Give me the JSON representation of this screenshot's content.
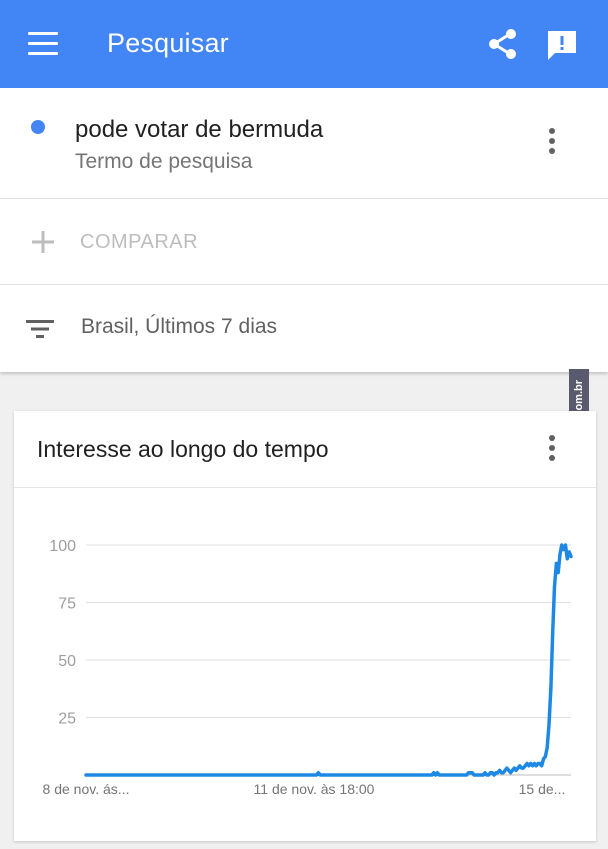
{
  "app_bar": {
    "title": "Pesquisar",
    "color": "#4285f4",
    "icons": [
      "menu-icon",
      "share-icon",
      "feedback-icon"
    ]
  },
  "search_term": {
    "name": "pode votar de bermuda",
    "type": "Termo de pesquisa",
    "color": "#4285f4"
  },
  "compare": {
    "label": "COMPARAR"
  },
  "filter": {
    "label": "Brasil, Últimos 7 dias"
  },
  "watermark": {
    "text": "AhNegao.com.br"
  },
  "chart_card": {
    "title": "Interesse ao longo do tempo"
  },
  "chart_data": {
    "type": "line",
    "title": "Interesse ao longo do tempo",
    "xlabel": "",
    "ylabel": "",
    "x_tick_labels": [
      "8 de nov. ás...",
      "11 de nov. às 18:00",
      "15 de..."
    ],
    "y_ticks": [
      25,
      50,
      75,
      100
    ],
    "ylim": [
      0,
      100
    ],
    "grid": true,
    "series": [
      {
        "color": "#1e88e5",
        "values": [
          0,
          0,
          0,
          0,
          0,
          0,
          0,
          0,
          0,
          0,
          0,
          0,
          0,
          0,
          0,
          0,
          0,
          0,
          0,
          0,
          0,
          0,
          0,
          0,
          0,
          0,
          0,
          0,
          0,
          0,
          0,
          0,
          0,
          0,
          0,
          0,
          0,
          0,
          0,
          0,
          0,
          0,
          0,
          0,
          0,
          0,
          0,
          0,
          0,
          0,
          0,
          0,
          0,
          0,
          0,
          0,
          0,
          0,
          0,
          0,
          0,
          0,
          0,
          0,
          0,
          0,
          0,
          0,
          0,
          0,
          0,
          0,
          0,
          0,
          0,
          0,
          0,
          0,
          0,
          0,
          0,
          0,
          0,
          0,
          0,
          0,
          0,
          0,
          0,
          0,
          0,
          0,
          0,
          0,
          0,
          0,
          0,
          0,
          0,
          0,
          0,
          0,
          0,
          0,
          0,
          0,
          0,
          0,
          0,
          0,
          0,
          0,
          0,
          0,
          0,
          0,
          0,
          0,
          0,
          0,
          0,
          0,
          0,
          0,
          0,
          0,
          0,
          1,
          0,
          0,
          0,
          0,
          0,
          0,
          0,
          0,
          0,
          0,
          0,
          0,
          0,
          0,
          0,
          0,
          0,
          0,
          0,
          0,
          0,
          0,
          0,
          0,
          0,
          0,
          0,
          0,
          0,
          0,
          0,
          0,
          0,
          0,
          0,
          0,
          0,
          0,
          0,
          0,
          0,
          0,
          0,
          0,
          0,
          0,
          0,
          0,
          0,
          0,
          0,
          0,
          0,
          0,
          0,
          0,
          0,
          0,
          0,
          0,
          0,
          0,
          1,
          0,
          1,
          0,
          0,
          0,
          0,
          0,
          0,
          0,
          0,
          0,
          0,
          0,
          0,
          0,
          0,
          0,
          0,
          1,
          1,
          1,
          0,
          0,
          0,
          0,
          0,
          0,
          1,
          0,
          0,
          1,
          1,
          0,
          1,
          1,
          2,
          1,
          1,
          2,
          3,
          2,
          1,
          2,
          3,
          2,
          3,
          4,
          3,
          3,
          4,
          5,
          4,
          5,
          4,
          5,
          4,
          5,
          5,
          4,
          7,
          8,
          12,
          22,
          38,
          62,
          82,
          92,
          88,
          96,
          100,
          98,
          100,
          94,
          97,
          95
        ]
      }
    ]
  }
}
